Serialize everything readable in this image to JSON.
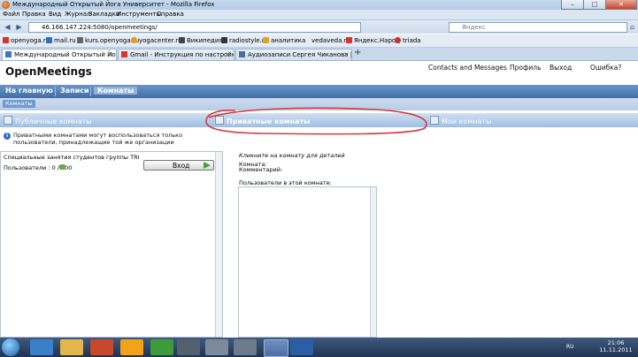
{
  "window": {
    "title": "Международный Открытый Йога Университет - Mozilla Firefox",
    "min": "–",
    "max": "□",
    "close": "✕"
  },
  "menu": [
    "Файл",
    "Правка",
    "Вид",
    "Журнал",
    "Закладки",
    "Инструменты",
    "Справка"
  ],
  "nav": {
    "url": "46.166.147.224:5080/openmeetings/",
    "search_placeholder": "Яндекс",
    "back": "◀",
    "forward": "▶"
  },
  "bookmarks": [
    {
      "label": "openyoga.ru",
      "color": "#d8342c"
    },
    {
      "label": "mail.ru",
      "color": "#2a6fc2"
    },
    {
      "label": "kurs.openyoga.ru",
      "color": "#555555"
    },
    {
      "label": "yogacenter.ru",
      "color": "#e69a1c"
    },
    {
      "label": "Википедия",
      "color": "#444444"
    },
    {
      "label": "radiostyle.ru",
      "color": "#333333"
    },
    {
      "label": "аналитика",
      "color": "#e5a31d"
    },
    {
      "label": "vedaveda.ru",
      "color": ""
    },
    {
      "label": "Яндекс.Народ",
      "color": "#d8342c"
    },
    {
      "label": "triada",
      "color": "#cc3333"
    }
  ],
  "tabs": [
    {
      "label": "Международный Открытый Йога У...",
      "active": true
    },
    {
      "label": "Gmail - Инструкция по настройке -...",
      "active": false
    },
    {
      "label": "Аудиозаписи Сергея Чиканова | 39 ...",
      "active": false
    }
  ],
  "new_tab": "+",
  "app": {
    "title": "OpenMeetings",
    "top_links": [
      "Contacts and Messages",
      "Профиль",
      "Выход",
      "Ошибка?"
    ],
    "main_nav": [
      "На главную",
      "Записи",
      "Комнаты"
    ],
    "breadcrumb": "Комнаты",
    "room_tabs": [
      "Публичные комнаты",
      "Приватные комнаты",
      "Мои комнаты"
    ],
    "info_text": "Приватными комнатами могут воспользоваться только пользователи, принадлежащие той же организации",
    "room": {
      "name": "Специальные занятия студентов группы TRI",
      "users": "Пользователи : 0 / 100",
      "join": "Вход"
    },
    "details": {
      "hint": "Кликните на комнату для деталей",
      "room_label": "Комната:",
      "comment_label": "Комментарий:",
      "users_label": "Пользователи в этой комнате:"
    }
  },
  "taskbar": {
    "time": "21:06",
    "date": "11.11.2011",
    "lang": "RU"
  },
  "colors": {
    "annotation": "#d23c3c",
    "nav_blue": "#3f6ea8",
    "taskbar": "#1f3352"
  }
}
